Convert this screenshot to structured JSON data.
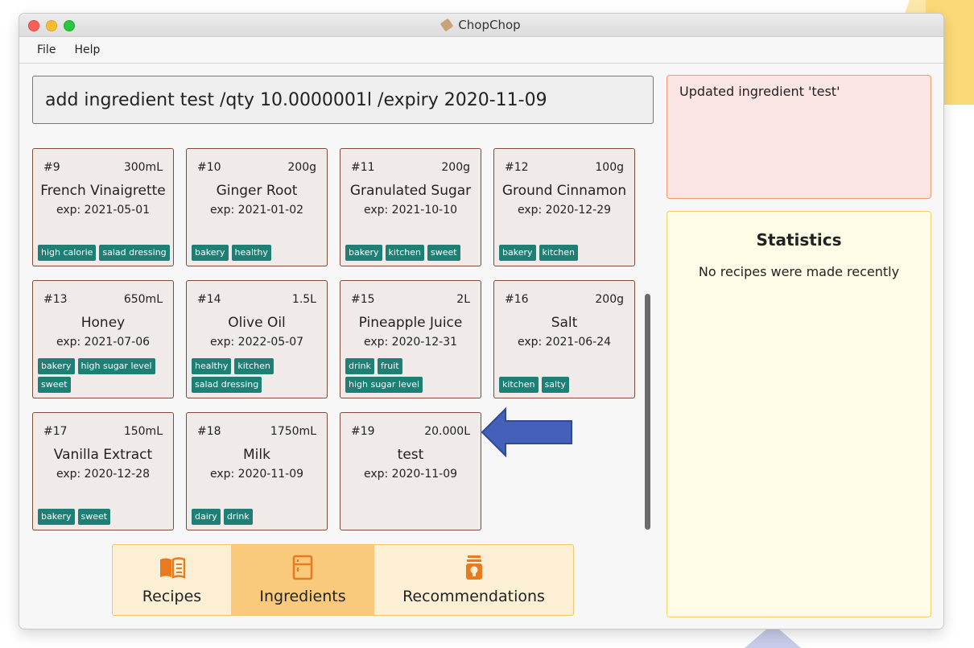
{
  "window": {
    "title": "ChopChop"
  },
  "menu": {
    "file": "File",
    "help": "Help"
  },
  "command": {
    "value": "add ingredient test /qty 10.0000001l /expiry 2020-11-09"
  },
  "ingredients": [
    {
      "index": "#9",
      "qty": "300mL",
      "name": "French Vinaigrette",
      "expiry": "exp: 2021-05-01",
      "tags": [
        "high calorie",
        "salad dressing"
      ]
    },
    {
      "index": "#10",
      "qty": "200g",
      "name": "Ginger Root",
      "expiry": "exp: 2021-01-02",
      "tags": [
        "bakery",
        "healthy"
      ]
    },
    {
      "index": "#11",
      "qty": "200g",
      "name": "Granulated Sugar",
      "expiry": "exp: 2021-10-10",
      "tags": [
        "bakery",
        "kitchen",
        "sweet"
      ]
    },
    {
      "index": "#12",
      "qty": "100g",
      "name": "Ground Cinnamon",
      "expiry": "exp: 2020-12-29",
      "tags": [
        "bakery",
        "kitchen"
      ]
    },
    {
      "index": "#13",
      "qty": "650mL",
      "name": "Honey",
      "expiry": "exp: 2021-07-06",
      "tags": [
        "bakery",
        "high sugar level",
        "sweet"
      ]
    },
    {
      "index": "#14",
      "qty": "1.5L",
      "name": "Olive Oil",
      "expiry": "exp: 2022-05-07",
      "tags": [
        "healthy",
        "kitchen",
        "salad dressing"
      ]
    },
    {
      "index": "#15",
      "qty": "2L",
      "name": "Pineapple Juice",
      "expiry": "exp: 2020-12-31",
      "tags": [
        "drink",
        "fruit",
        "high sugar level"
      ]
    },
    {
      "index": "#16",
      "qty": "200g",
      "name": "Salt",
      "expiry": "exp: 2021-06-24",
      "tags": [
        "kitchen",
        "salty"
      ]
    },
    {
      "index": "#17",
      "qty": "150mL",
      "name": "Vanilla Extract",
      "expiry": "exp: 2020-12-28",
      "tags": [
        "bakery",
        "sweet"
      ]
    },
    {
      "index": "#18",
      "qty": "1750mL",
      "name": "Milk",
      "expiry": "exp: 2020-11-09",
      "tags": [
        "dairy",
        "drink"
      ]
    },
    {
      "index": "#19",
      "qty": "20.000L",
      "name": "test",
      "expiry": "exp: 2020-11-09",
      "tags": []
    }
  ],
  "tabs": {
    "recipes": "Recipes",
    "ingredients": "Ingredients",
    "recommendations": "Recommendations"
  },
  "result": {
    "text": "Updated ingredient 'test'"
  },
  "statistics": {
    "title": "Statistics",
    "message": "No recipes were made recently"
  },
  "colors": {
    "tag": "#1e7f74",
    "accent": "#f9ca7b",
    "arrow": "#4460b8"
  },
  "icons": {
    "recipes": "book-icon",
    "ingredients": "fridge-icon",
    "recommendations": "lightbulb-jar-icon"
  }
}
